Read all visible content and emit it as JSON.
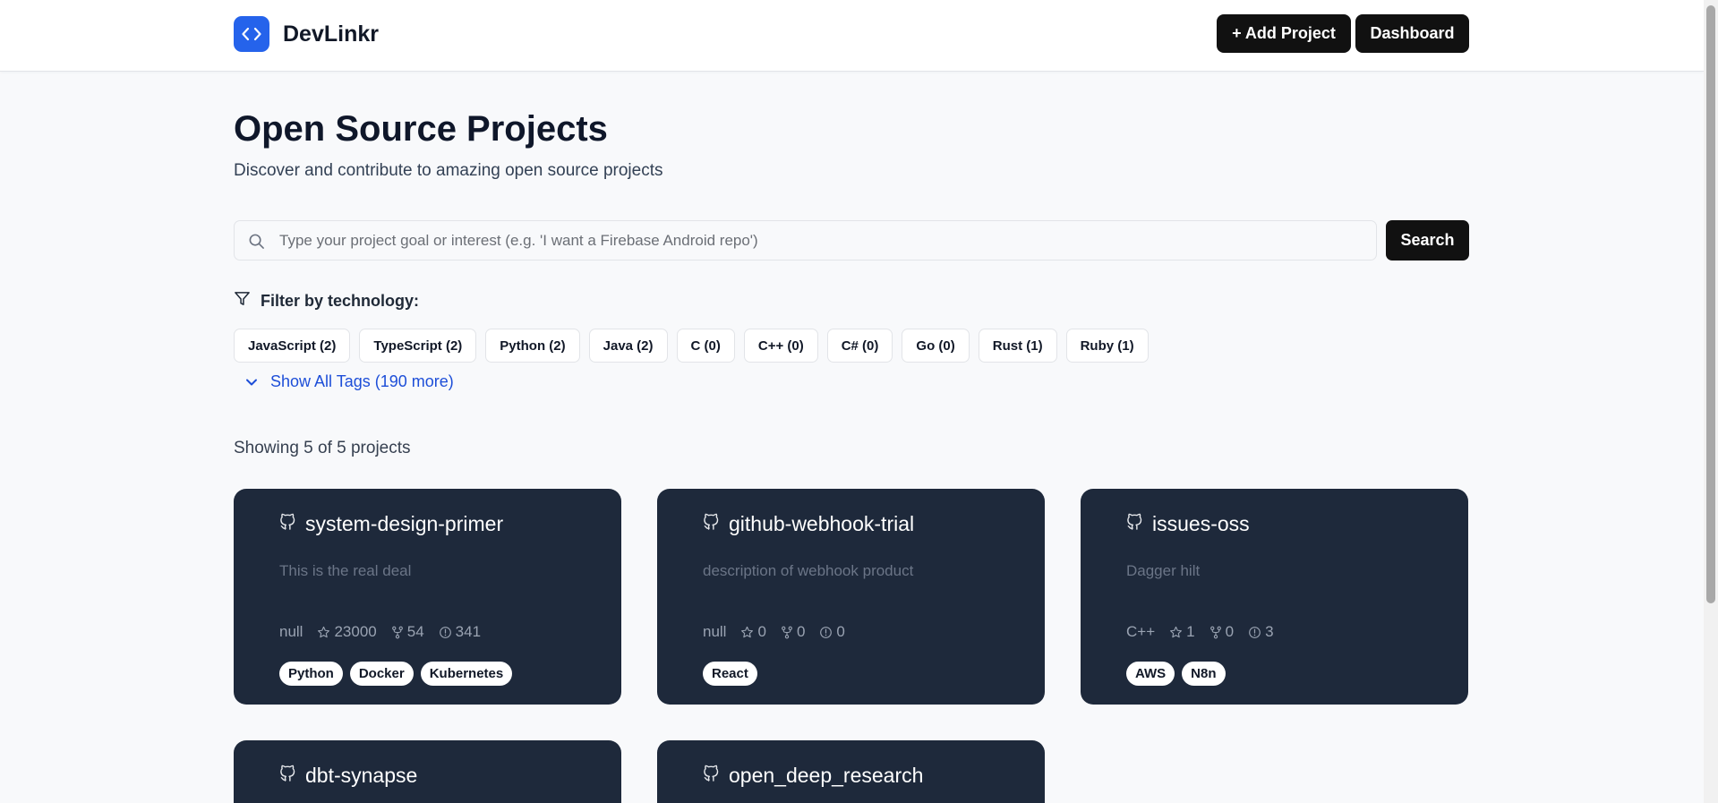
{
  "app": {
    "name": "DevLinkr"
  },
  "header": {
    "add_project_label": "+ Add Project",
    "dashboard_label": "Dashboard"
  },
  "main": {
    "title": "Open Source Projects",
    "subtitle": "Discover and contribute to amazing open source projects",
    "search": {
      "placeholder": "Type your project goal or interest (e.g. 'I want a Firebase Android repo')",
      "value": "",
      "button_label": "Search"
    },
    "filter": {
      "label": "Filter by technology:",
      "tags": [
        "JavaScript (2)",
        "TypeScript (2)",
        "Python (2)",
        "Java (2)",
        "C (0)",
        "C++ (0)",
        "C# (0)",
        "Go (0)",
        "Rust (1)",
        "Ruby (1)"
      ],
      "show_all_label": "Show All Tags (190 more)"
    },
    "showing_text": "Showing 5 of 5 projects",
    "projects": [
      {
        "name": "system-design-primer",
        "description": "This is the real deal",
        "language": "null",
        "stars": "23000",
        "forks": "54",
        "issues": "341",
        "tags": [
          "Python",
          "Docker",
          "Kubernetes"
        ]
      },
      {
        "name": "github-webhook-trial",
        "description": "description of webhook product",
        "language": "null",
        "stars": "0",
        "forks": "0",
        "issues": "0",
        "tags": [
          "React"
        ]
      },
      {
        "name": "issues-oss",
        "description": "Dagger hilt",
        "language": "C++",
        "stars": "1",
        "forks": "0",
        "issues": "3",
        "tags": [
          "AWS",
          "N8n"
        ]
      },
      {
        "name": "dbt-synapse"
      },
      {
        "name": "open_deep_research"
      }
    ]
  },
  "colors": {
    "brand": "#2563eb",
    "card_bg": "#1e293b",
    "button_bg": "#111111",
    "link": "#1d4ed8",
    "page_bg": "#f8f9fb"
  },
  "icons": {
    "logo": "code-brackets-icon",
    "search": "search-icon",
    "filter": "filter-icon",
    "show_all": "chevron-down-icon",
    "repo": "github-icon",
    "stars": "star-icon",
    "forks": "fork-icon",
    "issues": "issue-icon"
  }
}
